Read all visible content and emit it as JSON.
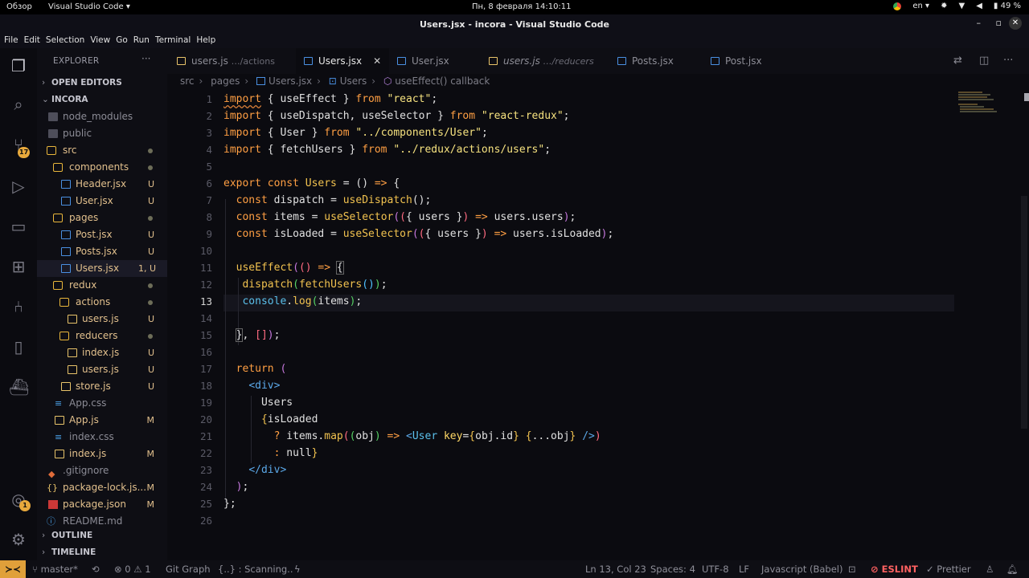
{
  "system_bar": {
    "activities": "Обзор",
    "app_menu": "Visual Studio Code ▾",
    "clock": "Пн, 8 февраля  14:10:11",
    "lang": "en ▾",
    "battery": "49 %"
  },
  "window": {
    "title": "Users.jsx - incora - Visual Studio Code",
    "minimize": "–",
    "restore": "▫",
    "close": "✕"
  },
  "menu": [
    "File",
    "Edit",
    "Selection",
    "View",
    "Go",
    "Run",
    "Terminal",
    "Help"
  ],
  "activity_bar": {
    "source_control_badge": "17",
    "accounts_badge": "1"
  },
  "sidebar": {
    "title": "EXPLORER",
    "more": "···",
    "open_editors": "OPEN EDITORS",
    "project": "INCORA",
    "outline": "OUTLINE",
    "timeline": "TIMELINE",
    "tree": [
      {
        "name": "node_modules",
        "status": ""
      },
      {
        "name": "public",
        "status": ""
      },
      {
        "name": "src",
        "status": ""
      },
      {
        "name": "components",
        "status": ""
      },
      {
        "name": "Header.jsx",
        "status": "U"
      },
      {
        "name": "User.jsx",
        "status": "U"
      },
      {
        "name": "pages",
        "status": ""
      },
      {
        "name": "Post.jsx",
        "status": "U"
      },
      {
        "name": "Posts.jsx",
        "status": "U"
      },
      {
        "name": "Users.jsx",
        "status": "1, U"
      },
      {
        "name": "redux",
        "status": ""
      },
      {
        "name": "actions",
        "status": ""
      },
      {
        "name": "users.js",
        "status": "U"
      },
      {
        "name": "reducers",
        "status": ""
      },
      {
        "name": "index.js",
        "status": "U"
      },
      {
        "name": "users.js",
        "status": "U"
      },
      {
        "name": "store.js",
        "status": "U"
      },
      {
        "name": "App.css",
        "status": ""
      },
      {
        "name": "App.js",
        "status": "M"
      },
      {
        "name": "index.css",
        "status": ""
      },
      {
        "name": "index.js",
        "status": "M"
      },
      {
        "name": ".gitignore",
        "status": ""
      },
      {
        "name": "package-lock.js...",
        "status": "M"
      },
      {
        "name": "package.json",
        "status": "M"
      },
      {
        "name": "README.md",
        "status": ""
      }
    ]
  },
  "tabs": [
    {
      "label": "users.js",
      "desc": "…/actions"
    },
    {
      "label": "Users.jsx",
      "desc": ""
    },
    {
      "label": "User.jsx",
      "desc": ""
    },
    {
      "label": "users.js",
      "desc": "…/reducers"
    },
    {
      "label": "Posts.jsx",
      "desc": ""
    },
    {
      "label": "Post.jsx",
      "desc": ""
    }
  ],
  "breadcrumb": [
    "src",
    "pages",
    "Users.jsx",
    "Users",
    "useEffect() callback"
  ],
  "editor": {
    "line_numbers": [
      "1",
      "2",
      "3",
      "4",
      "5",
      "6",
      "7",
      "8",
      "9",
      "10",
      "11",
      "12",
      "13",
      "14",
      "15",
      "16",
      "17",
      "18",
      "19",
      "20",
      "21",
      "22",
      "23",
      "24",
      "25",
      "26"
    ],
    "current_line": "13"
  },
  "statusbar": {
    "branch": "master*",
    "problems": "⊗ 0 ⚠ 1",
    "git_graph": "Git Graph",
    "scanning": "{..} : Scanning..",
    "position": "Ln 13, Col 23",
    "spaces": "Spaces: 4",
    "encoding": "UTF-8",
    "eol": "LF",
    "language": "Javascript (Babel)",
    "eslint": "ESLINT",
    "prettier": "✓ Prettier"
  }
}
